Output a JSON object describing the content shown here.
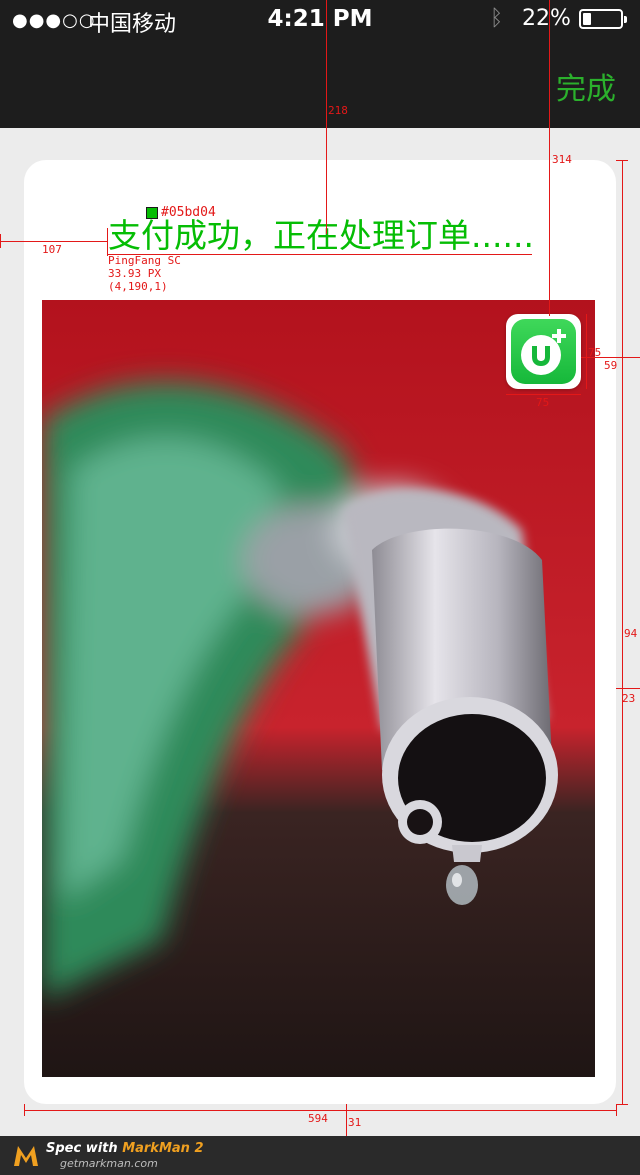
{
  "status_bar": {
    "signal": "●●●○○",
    "carrier": "中国移动",
    "time": "4:21 PM",
    "bluetooth_icon": "ᛒ",
    "battery": "22%",
    "battery_level": 0.22
  },
  "nav": {
    "done_label": "完成"
  },
  "card": {
    "title": "支付成功，正在处理订单......"
  },
  "spec": {
    "color": "#05bd04",
    "font": "PingFang SC",
    "size": "33.93 PX",
    "coords": "(4,190,1)",
    "left_offset": "107",
    "top_offset": "218",
    "icon_top": "314",
    "icon_size_h": "75",
    "icon_size_v": "75",
    "icon_right": "59",
    "height": "94",
    "gap": "23",
    "card_width": "594",
    "bottom": "31"
  },
  "footer": {
    "brand_prefix": "Spec with ",
    "brand_name": "MarkMan 2",
    "url": "getmarkman.com"
  },
  "colors": {
    "accent": "#05bd04",
    "nav_bg": "#1d1d1d",
    "annotation": "#e31818"
  },
  "icons": {
    "app": "u-plus-app-icon",
    "footer_logo": "markman-logo"
  }
}
